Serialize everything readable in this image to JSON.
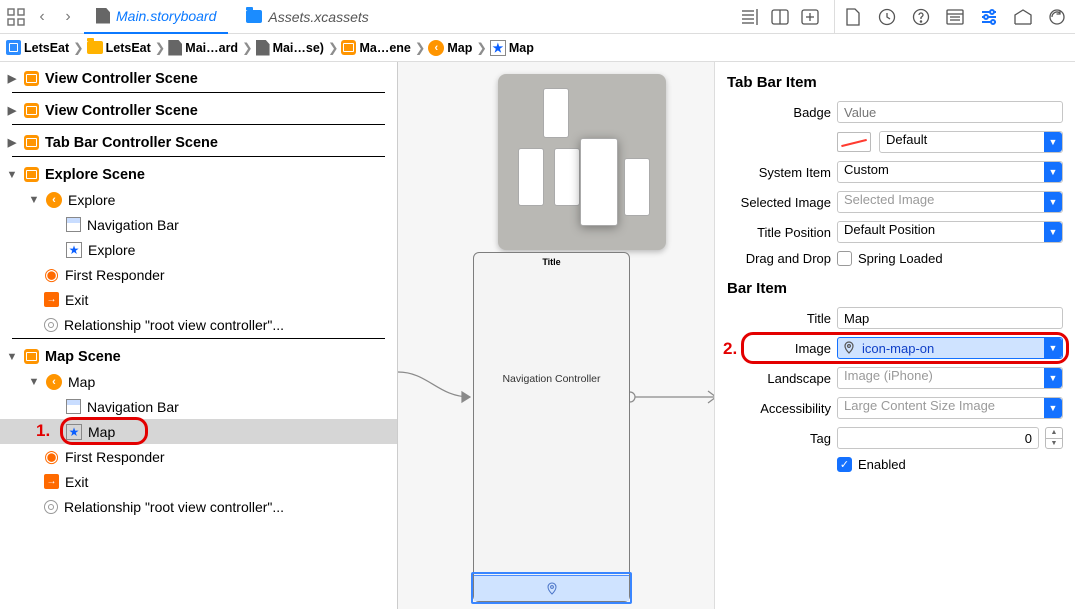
{
  "tabs": [
    {
      "label": "Main.storyboard",
      "active": true
    },
    {
      "label": "Assets.xcassets",
      "active": false
    }
  ],
  "breadcrumbs": [
    {
      "icon": "proj",
      "label": "LetsEat"
    },
    {
      "icon": "folder",
      "label": "LetsEat"
    },
    {
      "icon": "file",
      "label": "Mai…ard"
    },
    {
      "icon": "file",
      "label": "Mai…se)"
    },
    {
      "icon": "scene",
      "label": "Ma…ene"
    },
    {
      "icon": "circle",
      "label": "Map"
    },
    {
      "icon": "star",
      "label": "Map"
    }
  ],
  "outline": {
    "vcs1": "View Controller Scene",
    "vcs2": "View Controller Scene",
    "tbcs": "Tab Bar Controller Scene",
    "explore_scene": "Explore Scene",
    "explore": "Explore",
    "navbar": "Navigation Bar",
    "explore_item": "Explore",
    "first_responder": "First Responder",
    "exit": "Exit",
    "relationship": "Relationship \"root view controller\"...",
    "map_scene": "Map Scene",
    "map": "Map",
    "map_item": "Map"
  },
  "canvas": {
    "title": "Title",
    "navctrl": "Navigation Controller"
  },
  "annot": {
    "one": "1.",
    "two": "2."
  },
  "inspector": {
    "section1": "Tab Bar Item",
    "badge_label": "Badge",
    "badge_ph": "Value",
    "default_label": "Default",
    "system_item_label": "System Item",
    "system_item_val": "Custom",
    "selected_image_label": "Selected Image",
    "selected_image_ph": "Selected Image",
    "title_position_label": "Title Position",
    "title_position_val": "Default Position",
    "drag_label": "Drag and Drop",
    "spring_label": "Spring Loaded",
    "section2": "Bar Item",
    "title_label": "Title",
    "title_val": "Map",
    "image_label": "Image",
    "image_val": "icon-map-on",
    "landscape_label": "Landscape",
    "landscape_ph": "Image (iPhone)",
    "access_label": "Accessibility",
    "access_ph": "Large Content Size Image",
    "tag_label": "Tag",
    "tag_val": "0",
    "enabled_label": "Enabled"
  }
}
